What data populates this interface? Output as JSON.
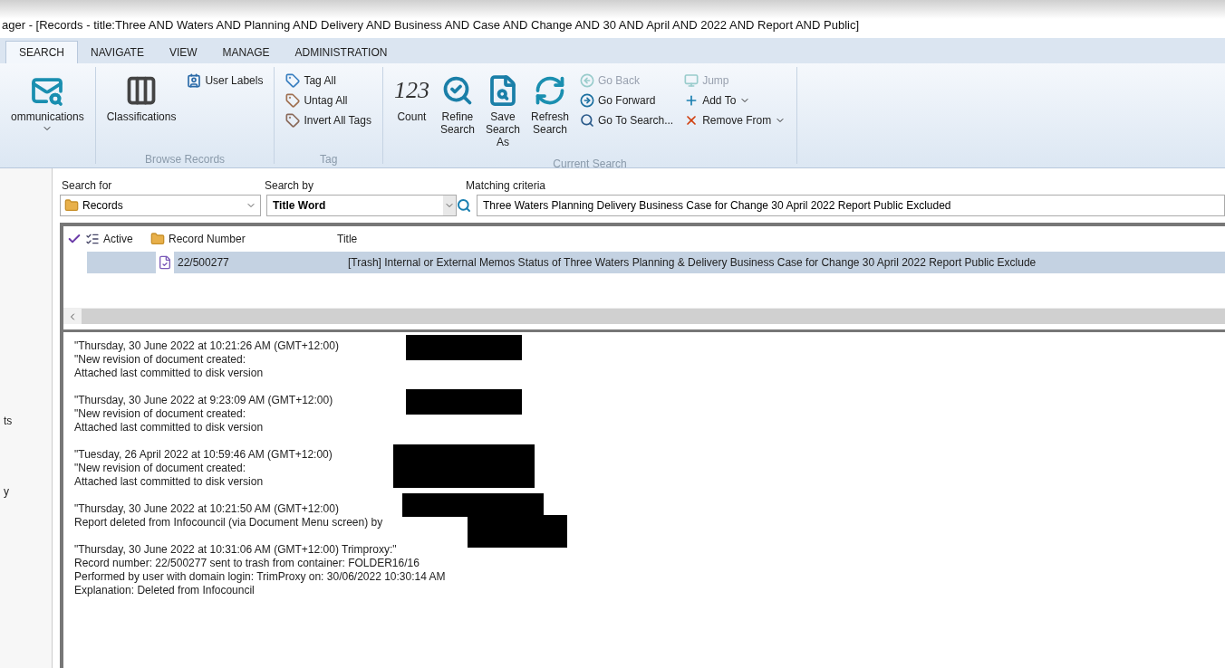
{
  "window": {
    "title": "ager - [Records - title:Three AND Waters AND Planning AND Delivery AND Business AND Case AND Change AND 30 AND April AND 2022 AND Report AND Public]"
  },
  "tabs": [
    {
      "label": "SEARCH",
      "selected": true
    },
    {
      "label": "NAVIGATE",
      "selected": false
    },
    {
      "label": "VIEW",
      "selected": false
    },
    {
      "label": "MANAGE",
      "selected": false
    },
    {
      "label": "ADMINISTRATION",
      "selected": false
    }
  ],
  "ribbon": {
    "groups": [
      {
        "items": [
          {
            "kind": "large",
            "label": "ommunications",
            "dropdown": true,
            "disabled": false
          }
        ]
      },
      {
        "label": "Browse Records",
        "items": [
          {
            "kind": "large",
            "label": "Classifications",
            "dropdown": false,
            "disabled": false
          },
          {
            "kind": "small",
            "label": "User Labels",
            "dropdown": false,
            "disabled": false
          }
        ]
      },
      {
        "label": "Tag",
        "items": [
          {
            "kind": "small",
            "label": "Tag All",
            "dropdown": false,
            "disabled": false
          },
          {
            "kind": "small",
            "label": "Untag All",
            "dropdown": false,
            "disabled": false
          },
          {
            "kind": "small",
            "label": "Invert All Tags",
            "dropdown": false,
            "disabled": false
          }
        ]
      },
      {
        "label": "Current Search",
        "items": [
          {
            "kind": "large",
            "label": "Count",
            "glyph": "123",
            "dropdown": false,
            "disabled": false
          },
          {
            "kind": "large",
            "label": "Refine Search",
            "dropdown": false,
            "disabled": false
          },
          {
            "kind": "large",
            "label": "Save Search As",
            "dropdown": false,
            "disabled": false
          },
          {
            "kind": "large",
            "label": "Refresh Search",
            "dropdown": false,
            "disabled": false
          },
          {
            "kind": "small",
            "label": "Go Back",
            "dropdown": false,
            "disabled": true
          },
          {
            "kind": "small",
            "label": "Go Forward",
            "dropdown": false,
            "disabled": false
          },
          {
            "kind": "small",
            "label": "Go To Search...",
            "dropdown": false,
            "disabled": false
          },
          {
            "kind": "small",
            "label": "Jump",
            "dropdown": false,
            "disabled": true
          },
          {
            "kind": "small",
            "label": "Add To",
            "dropdown": true,
            "disabled": false
          },
          {
            "kind": "small",
            "label": "Remove From",
            "dropdown": true,
            "disabled": false
          }
        ]
      }
    ]
  },
  "sidebar": {
    "items": [
      "ts",
      "y"
    ]
  },
  "search": {
    "search_for": {
      "label": "Search for",
      "value": "Records"
    },
    "search_by": {
      "label": "Search by",
      "value": "Title Word"
    },
    "matching_criteria": {
      "label": "Matching criteria",
      "value": "Three Waters Planning Delivery Business Case for Change 30 April 2022 Report Public Excluded"
    }
  },
  "table": {
    "columns": [
      "Active",
      "Record Number",
      "Title"
    ],
    "rows": [
      {
        "record_number": "22/500277",
        "title": "[Trash] Internal or External Memos Status of Three Waters Planning & Delivery Business Case for Change 30 April 2022 Report Public Exclude",
        "selected": true
      }
    ]
  },
  "notes": [
    {
      "kind": "line",
      "lines": [
        "\"Thursday, 30 June 2022 at 10:21:26 AM (GMT+12:00)",
        "\"New revision of document created:",
        "Attached last committed to disk version"
      ]
    },
    {
      "kind": "line",
      "lines": [
        "\"Thursday, 30 June 2022 at 9:23:09 AM (GMT+12:00)",
        "\"New revision of document created:",
        "Attached last committed to disk version"
      ]
    },
    {
      "kind": "block",
      "lines": [
        "\"Tuesday, 26 April 2022 at 10:59:46 AM (GMT+12:00)",
        "\"New revision of document created:",
        "Attached last committed to disk version"
      ]
    },
    {
      "kind": "stepped",
      "lines": [
        "\"Thursday, 30 June 2022 at 10:21:50 AM (GMT+12:00)",
        "Report deleted from Infocouncil (via Document Menu screen) by"
      ]
    },
    {
      "kind": "plain",
      "lines": [
        "\"Thursday, 30 June 2022 at 10:31:06 AM (GMT+12:00)   Trimproxy:\"",
        "Record number: 22/500277 sent to trash from container: FOLDER16/16",
        "Performed by user with domain login: TrimProxy on: 30/06/2022 10:30:14 AM",
        "Explanation: Deleted from Infocouncil"
      ]
    }
  ]
}
